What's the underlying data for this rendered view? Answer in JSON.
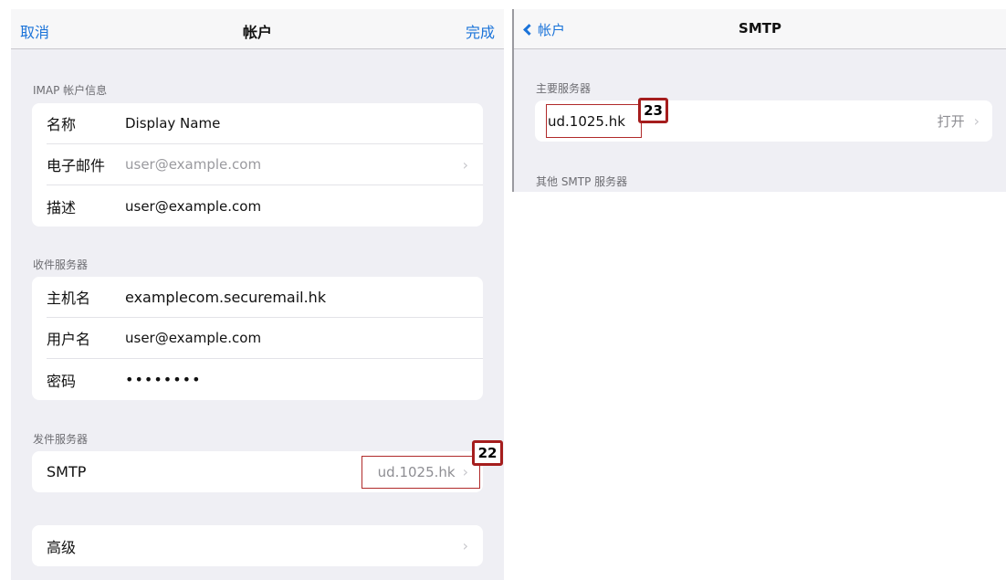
{
  "left": {
    "nav": {
      "cancel": "取消",
      "title": "帐户",
      "done": "完成"
    },
    "imap_section": {
      "header": "IMAP 帐户信息",
      "rows": [
        {
          "label": "名称",
          "value": "Display Name"
        },
        {
          "label": "电子邮件",
          "value": "user@example.com",
          "chevron": "›"
        },
        {
          "label": "描述",
          "value": "user@example.com"
        }
      ]
    },
    "incoming_section": {
      "header": "收件服务器",
      "rows": [
        {
          "label": "主机名",
          "value": "examplecom.securemail.hk"
        },
        {
          "label": "用户名",
          "value": "user@example.com"
        },
        {
          "label": "密码",
          "value": "••••••••"
        }
      ]
    },
    "outgoing_section": {
      "header": "发件服务器",
      "smtp": {
        "label": "SMTP",
        "value": "ud.1025.hk",
        "chevron": "›"
      }
    },
    "advanced": {
      "label": "高级",
      "chevron": "›"
    },
    "badge": "22"
  },
  "right": {
    "nav": {
      "back": "帐户",
      "title": "SMTP"
    },
    "primary_header": "主要服务器",
    "primary_server": {
      "value": "ud.1025.hk",
      "status": "打开",
      "chevron": "›"
    },
    "other_header": "其他 SMTP 服务器",
    "badge": "23"
  }
}
